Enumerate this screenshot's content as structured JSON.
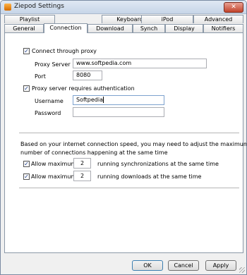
{
  "window": {
    "title": "Ziepod Settings",
    "close_label": "✕"
  },
  "tabs_back": [
    "Playlist",
    "Keyboard",
    "iPod",
    "Advanced"
  ],
  "tabs_front": [
    "General",
    "Connection",
    "Download",
    "Synch",
    "Display",
    "Notifiers"
  ],
  "active_tab": "Connection",
  "proxy": {
    "use_proxy_label": "Connect through proxy",
    "use_proxy_checked": true,
    "server_label": "Proxy Server",
    "server_value": "www.softpedia.com",
    "port_label": "Port",
    "port_value": "8080"
  },
  "auth": {
    "requires_auth_label": "Proxy server requires authentication",
    "requires_auth_checked": true,
    "username_label": "Username",
    "username_value": "Softpedia",
    "password_label": "Password",
    "password_value": ""
  },
  "connections": {
    "info_line1": "Based on your internet connection speed, you may need to adjust the maximum",
    "info_line2": "number of connections happening at the same time",
    "sync": {
      "label": "Allow maximum",
      "value": "2",
      "suffix": "running synchronizations at the same time",
      "checked": true
    },
    "downloads": {
      "label": "Allow maximum",
      "value": "2",
      "suffix": "running downloads at the same time",
      "checked": true
    }
  },
  "buttons": {
    "ok": "OK",
    "cancel": "Cancel",
    "apply": "Apply"
  }
}
